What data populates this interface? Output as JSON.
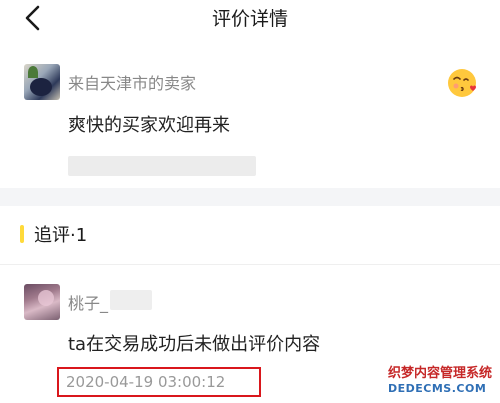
{
  "header": {
    "title": "评价详情",
    "back_icon": "chevron-left-icon"
  },
  "seller_review": {
    "name": "来自天津市的卖家",
    "text": "爽快的买家欢迎再来",
    "emoji_icon": "kiss-emoji-icon"
  },
  "followup": {
    "title": "追评·1",
    "accent_color": "#ffda3a",
    "buyer_name": "桃子_",
    "text": "ta在交易成功后未做出评价内容",
    "timestamp": "2020-04-19 03:00:12",
    "highlight_color": "#d9171c"
  },
  "watermark": {
    "line1": "织梦内容管理系统",
    "line2": "DEDECMS.COM"
  }
}
